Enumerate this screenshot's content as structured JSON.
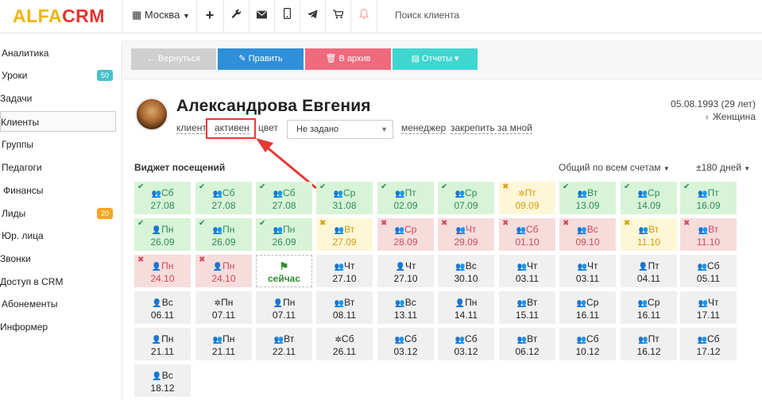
{
  "header": {
    "logo_alfa": "ALFA",
    "logo_crm": "CRM",
    "city": "Москва",
    "search_placeholder": "Поиск клиента"
  },
  "sidebar": {
    "items": [
      {
        "label": "Аналитика",
        "badge": ""
      },
      {
        "label": "Уроки",
        "badge": "50"
      },
      {
        "label": "Задачи",
        "badge": ""
      },
      {
        "label": "Клиенты",
        "badge": ""
      },
      {
        "label": "Группы",
        "badge": ""
      },
      {
        "label": "Педагоги",
        "badge": ""
      },
      {
        "label": "Финансы",
        "badge": ""
      },
      {
        "label": "Лиды",
        "badge": "20"
      },
      {
        "label": "Юр. лица",
        "badge": ""
      },
      {
        "label": "Звонки",
        "badge": ""
      },
      {
        "label": "Доступ в CRM",
        "badge": ""
      },
      {
        "label": "Абонементы",
        "badge": ""
      },
      {
        "label": "Информер",
        "badge": ""
      }
    ],
    "active_index": 3
  },
  "toolbar": {
    "back_label": "← Вернуться",
    "edit_label": "✎ Править",
    "archive_label": "🗑 В архив",
    "reports_label": "▤ Отчеты ▾"
  },
  "client": {
    "name": "Александрова Евгения",
    "dob": "05.08.1993 (29 лет)",
    "gender": "Женщина",
    "type_label": "клиент",
    "status_label": "активен",
    "color_label": "цвет",
    "manager_select": "Не задано",
    "manager_label": "менеджер",
    "assign_label": "закрепить за мной"
  },
  "widget": {
    "title": "Виджет посещений",
    "account_filter": "Общий по всем счетам",
    "range_filter": "±180 дней",
    "rows": [
      [
        {
          "day": "Сб",
          "date": "27.08",
          "status": "green",
          "icon": "group",
          "mark": "check"
        },
        {
          "day": "Сб",
          "date": "27.08",
          "status": "green",
          "icon": "group",
          "mark": "check"
        },
        {
          "day": "Сб",
          "date": "27.08",
          "status": "green",
          "icon": "group",
          "mark": "check"
        },
        {
          "day": "Ср",
          "date": "31.08",
          "status": "green",
          "icon": "group",
          "mark": "check"
        },
        {
          "day": "Пт",
          "date": "02.09",
          "status": "green",
          "icon": "group",
          "mark": "check"
        },
        {
          "day": "Ср",
          "date": "07.09",
          "status": "green",
          "icon": "group",
          "mark": "check"
        },
        {
          "day": "Пт",
          "date": "09.09",
          "status": "yellow",
          "icon": "trial",
          "mark": "cross"
        },
        {
          "day": "Вт",
          "date": "13.09",
          "status": "green",
          "icon": "group",
          "mark": "check"
        },
        {
          "day": "Ср",
          "date": "14.09",
          "status": "green",
          "icon": "group",
          "mark": "check"
        },
        {
          "day": "Пт",
          "date": "16.09",
          "status": "green",
          "icon": "group",
          "mark": "check"
        }
      ],
      [
        {
          "day": "Пн",
          "date": "26.09",
          "status": "green",
          "icon": "person",
          "mark": "check"
        },
        {
          "day": "Пн",
          "date": "26.09",
          "status": "green",
          "icon": "group",
          "mark": "check"
        },
        {
          "day": "Пн",
          "date": "26.09",
          "status": "green",
          "icon": "group",
          "mark": "check"
        },
        {
          "day": "Вт",
          "date": "27.09",
          "status": "yellow",
          "icon": "group",
          "mark": "cross"
        },
        {
          "day": "Ср",
          "date": "28.09",
          "status": "red",
          "icon": "group",
          "mark": "cross"
        },
        {
          "day": "Чт",
          "date": "29.09",
          "status": "red",
          "icon": "group",
          "mark": "cross"
        },
        {
          "day": "Сб",
          "date": "01.10",
          "status": "red",
          "icon": "group",
          "mark": "cross"
        },
        {
          "day": "Вс",
          "date": "09.10",
          "status": "red",
          "icon": "group",
          "mark": "cross"
        },
        {
          "day": "Вт",
          "date": "11.10",
          "status": "yellow",
          "icon": "group",
          "mark": "cross"
        },
        {
          "day": "Вт",
          "date": "11.10",
          "status": "red",
          "icon": "group",
          "mark": "cross"
        }
      ],
      [
        {
          "day": "Пн",
          "date": "24.10",
          "status": "red",
          "icon": "person",
          "mark": "cross"
        },
        {
          "day": "Пн",
          "date": "24.10",
          "status": "red",
          "icon": "person",
          "mark": "cross"
        },
        {
          "day": "",
          "date": "сейчас",
          "status": "now",
          "icon": "flag",
          "mark": ""
        },
        {
          "day": "Чт",
          "date": "27.10",
          "status": "gray",
          "icon": "group",
          "mark": ""
        },
        {
          "day": "Чт",
          "date": "27.10",
          "status": "gray",
          "icon": "person",
          "mark": ""
        },
        {
          "day": "Вс",
          "date": "30.10",
          "status": "gray",
          "icon": "group",
          "mark": ""
        },
        {
          "day": "Чт",
          "date": "03.11",
          "status": "gray",
          "icon": "group",
          "mark": ""
        },
        {
          "day": "Чт",
          "date": "03.11",
          "status": "gray",
          "icon": "group",
          "mark": ""
        },
        {
          "day": "Пт",
          "date": "04.11",
          "status": "gray",
          "icon": "person",
          "mark": ""
        },
        {
          "day": "Сб",
          "date": "05.11",
          "status": "gray",
          "icon": "group",
          "mark": ""
        }
      ],
      [
        {
          "day": "Вс",
          "date": "06.11",
          "status": "gray",
          "icon": "person",
          "mark": ""
        },
        {
          "day": "Пн",
          "date": "07.11",
          "status": "gray",
          "icon": "trial",
          "mark": ""
        },
        {
          "day": "Пн",
          "date": "07.11",
          "status": "gray",
          "icon": "person",
          "mark": ""
        },
        {
          "day": "Вт",
          "date": "08.11",
          "status": "gray",
          "icon": "group",
          "mark": ""
        },
        {
          "day": "Вс",
          "date": "13.11",
          "status": "gray",
          "icon": "group",
          "mark": ""
        },
        {
          "day": "Пн",
          "date": "14.11",
          "status": "gray",
          "icon": "person",
          "mark": ""
        },
        {
          "day": "Вт",
          "date": "15.11",
          "status": "gray",
          "icon": "group",
          "mark": ""
        },
        {
          "day": "Ср",
          "date": "16.11",
          "status": "gray",
          "icon": "group",
          "mark": ""
        },
        {
          "day": "Ср",
          "date": "16.11",
          "status": "gray",
          "icon": "group",
          "mark": ""
        },
        {
          "day": "Чт",
          "date": "17.11",
          "status": "gray",
          "icon": "group",
          "mark": ""
        }
      ],
      [
        {
          "day": "Пн",
          "date": "21.11",
          "status": "gray",
          "icon": "person",
          "mark": ""
        },
        {
          "day": "Пн",
          "date": "21.11",
          "status": "gray",
          "icon": "group",
          "mark": ""
        },
        {
          "day": "Вт",
          "date": "22.11",
          "status": "gray",
          "icon": "group",
          "mark": ""
        },
        {
          "day": "Сб",
          "date": "26.11",
          "status": "gray",
          "icon": "trial",
          "mark": ""
        },
        {
          "day": "Сб",
          "date": "03.12",
          "status": "gray",
          "icon": "group",
          "mark": ""
        },
        {
          "day": "Сб",
          "date": "03.12",
          "status": "gray",
          "icon": "group",
          "mark": ""
        },
        {
          "day": "Вт",
          "date": "06.12",
          "status": "gray",
          "icon": "group",
          "mark": ""
        },
        {
          "day": "Сб",
          "date": "10.12",
          "status": "gray",
          "icon": "group",
          "mark": ""
        },
        {
          "day": "Пт",
          "date": "16.12",
          "status": "gray",
          "icon": "group",
          "mark": ""
        },
        {
          "day": "Сб",
          "date": "17.12",
          "status": "gray",
          "icon": "group",
          "mark": ""
        }
      ],
      [
        {
          "day": "Вс",
          "date": "18.12",
          "status": "gray",
          "icon": "person",
          "mark": ""
        }
      ]
    ]
  },
  "icons": {
    "person": "👤",
    "group": "👥",
    "trial": "✲",
    "flag": "⚑",
    "check": "✔",
    "cross": "✖"
  },
  "colors": {
    "back_button": "#cfcfcf",
    "edit_button": "#2f8fd8",
    "archive_button": "#f06a7e",
    "reports_button": "#3fd6cf",
    "lessons_badge": "#46c1c9",
    "leads_badge": "#f5a623",
    "highlight_box": "#e53935"
  }
}
